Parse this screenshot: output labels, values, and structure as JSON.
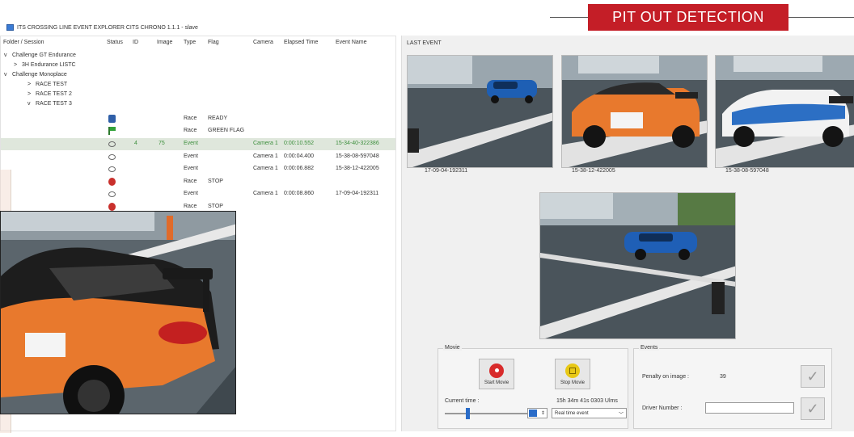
{
  "banner": {
    "text": "PIT OUT DETECTION",
    "color": "#c41e27"
  },
  "window": {
    "title": "ITS CROSSING LINE EVENT EXPLORER CITS CHRONO 1.1.1 - slave"
  },
  "tree": {
    "columns": [
      "Folder / Session",
      "Status",
      "ID",
      "Image",
      "Type",
      "Flag",
      "Camera",
      "Elapsed Time",
      "Event Name"
    ],
    "nodes": [
      {
        "caret": "v",
        "label": "Challenge GT Endurance"
      },
      {
        "caret": ">",
        "label": "3H Endurance LISTC"
      },
      {
        "caret": "v",
        "label": "Challenge Monoplace"
      },
      {
        "caret": ">",
        "label": "RACE TEST"
      },
      {
        "caret": ">",
        "label": "RACE TEST 2"
      },
      {
        "caret": "v",
        "label": "RACE TEST 3"
      }
    ],
    "rows": [
      {
        "status": "blue",
        "id": "",
        "image": "",
        "type": "Race",
        "flag": "READY",
        "camera": "",
        "elapsed": "",
        "event": ""
      },
      {
        "status": "flag",
        "id": "",
        "image": "",
        "type": "Race",
        "flag": "GREEN FLAG",
        "camera": "",
        "elapsed": "",
        "event": ""
      },
      {
        "status": "eye",
        "id": "4",
        "image": "75",
        "type": "Event",
        "flag": "",
        "camera": "Camera 1",
        "elapsed": "0:00:10.552",
        "event": "15-34-40-322386",
        "selected": true
      },
      {
        "status": "eye",
        "id": "",
        "image": "",
        "type": "Event",
        "flag": "",
        "camera": "Camera 1",
        "elapsed": "0:00:04.400",
        "event": "15-38-08-597048"
      },
      {
        "status": "eye",
        "id": "",
        "image": "",
        "type": "Event",
        "flag": "",
        "camera": "Camera 1",
        "elapsed": "0:00:06.882",
        "event": "15-38-12-422005"
      },
      {
        "status": "stop",
        "id": "",
        "image": "",
        "type": "Race",
        "flag": "STOP",
        "camera": "",
        "elapsed": "",
        "event": ""
      },
      {
        "status": "eye",
        "id": "",
        "image": "",
        "type": "Event",
        "flag": "",
        "camera": "Camera 1",
        "elapsed": "0:00:08.860",
        "event": "17-09-04-192311"
      },
      {
        "status": "stop",
        "id": "",
        "image": "",
        "type": "Race",
        "flag": "STOP",
        "camera": "",
        "elapsed": "",
        "event": ""
      }
    ]
  },
  "last_event": {
    "label": "LAST EVENT",
    "thumbs": [
      "17-09-04-192311",
      "15-38-12-422005",
      "15-38-08-597048"
    ]
  },
  "movie": {
    "title": "Movie",
    "start_label": "Start Movie",
    "stop_label": "Stop Movie",
    "current_time_label": "Current time :",
    "current_time_value": "15h 34m 41s 0303 Ulms",
    "speed_value": "Real time event"
  },
  "events": {
    "title": "Events",
    "penalty_label": "Penalty on image :",
    "penalty_value": "39",
    "driver_label": "Driver Number :",
    "driver_value": ""
  }
}
